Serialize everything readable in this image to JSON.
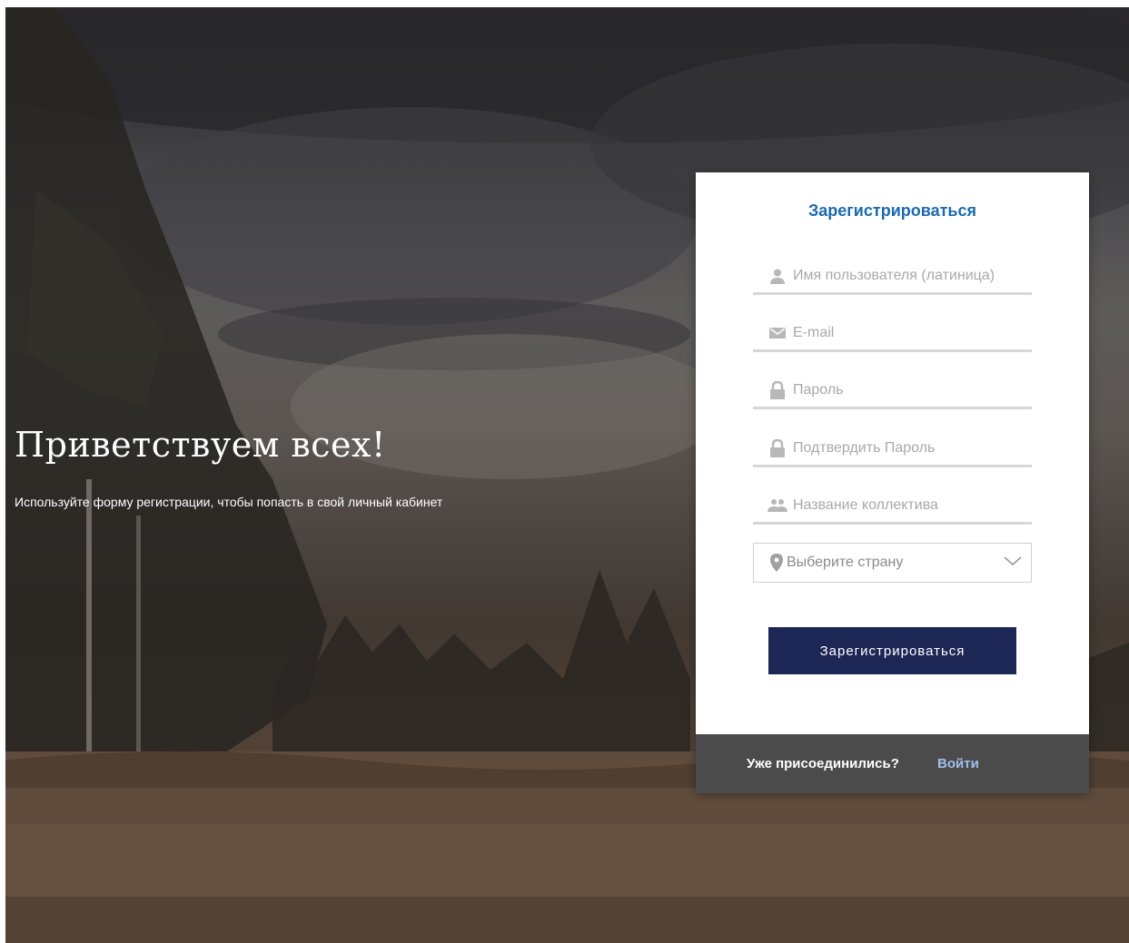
{
  "hero": {
    "title": "Приветствуем всех!",
    "subtitle": "Используйте форму регистрации, чтобы попасть в свой личный кабинет"
  },
  "form": {
    "title": "Зарегистрироваться",
    "fields": [
      {
        "placeholder": "Имя пользователя (латиница)",
        "value": "",
        "icon": "user-icon"
      },
      {
        "placeholder": "E-mail",
        "value": "",
        "icon": "envelope-icon"
      },
      {
        "placeholder": "Пароль",
        "value": "",
        "icon": "lock-icon"
      },
      {
        "placeholder": "Подтвердить Пароль",
        "value": "",
        "icon": "lock-icon"
      },
      {
        "placeholder": "Название коллектива",
        "value": "",
        "icon": "users-icon"
      }
    ],
    "country_select": {
      "selected": "Выберите страну",
      "icon": "map-marker-icon"
    },
    "submit_label": "Зарегистрироваться"
  },
  "footer": {
    "question": "Уже присоединились?",
    "login_label": "Войти"
  },
  "colors": {
    "title_blue": "#1a6ab0",
    "button_navy": "#1d2755",
    "footer_gray": "#4b4b4b",
    "login_link": "#9fc0ea",
    "field_underline": "#d7d7d7"
  }
}
